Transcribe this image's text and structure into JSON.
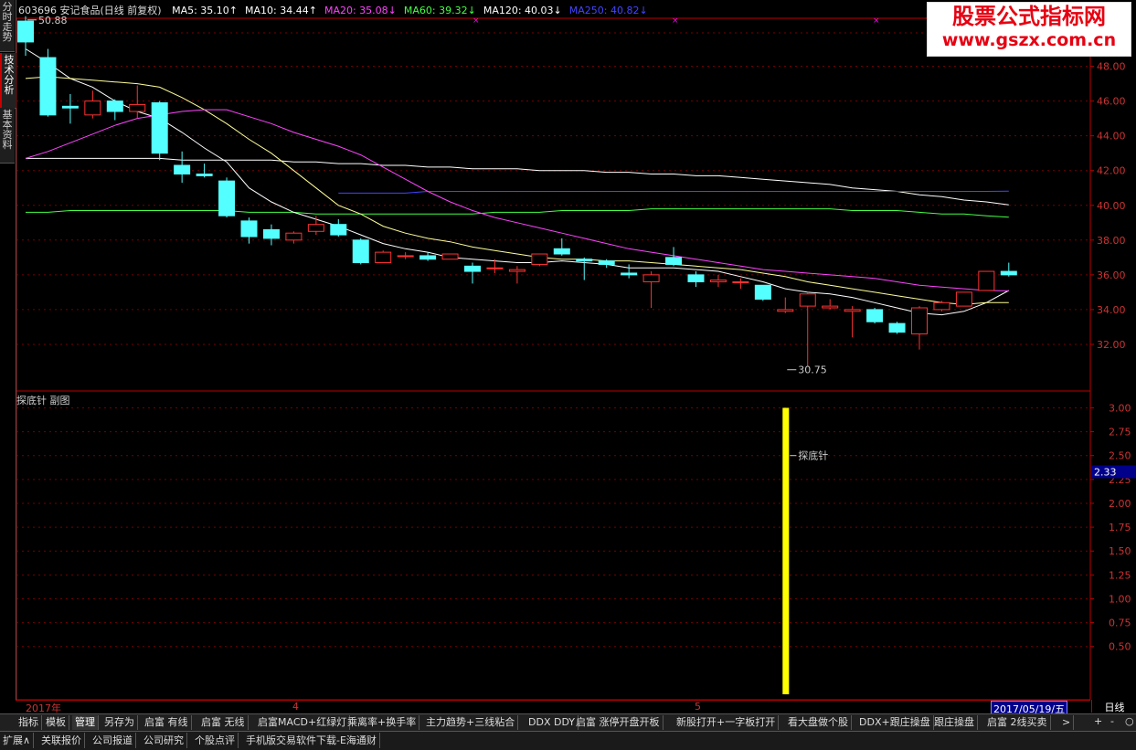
{
  "side_tabs": [
    {
      "label": "分时走势"
    },
    {
      "label": "技术分析"
    },
    {
      "label": "基本资料"
    }
  ],
  "header": {
    "stock": "603696 安记食品(日线 前复权)",
    "ma": [
      {
        "label": "MA5: 35.10",
        "arrow": "↑",
        "color": "#ffffff"
      },
      {
        "label": "MA10: 34.44",
        "arrow": "↑",
        "color": "#ffffff"
      },
      {
        "label": "MA20: 35.08",
        "arrow": "↓",
        "color": "#ff44ff"
      },
      {
        "label": "MA60: 39.32",
        "arrow": "↓",
        "color": "#44ff44"
      },
      {
        "label": "MA120: 40.03",
        "arrow": "↓",
        "color": "#ffffff"
      },
      {
        "label": "MA250: 40.82",
        "arrow": "↓",
        "color": "#4444ff"
      }
    ]
  },
  "logo": {
    "line1": "股票公式指标网",
    "line2": "www.gszx.com.cn"
  },
  "sub_chart_label": "探底针 副图",
  "axis_bar": {
    "labels": [
      {
        "text": "2017年",
        "x": 28
      },
      {
        "text": "4",
        "x": 320
      },
      {
        "text": "5",
        "x": 760
      }
    ],
    "date_flag": "2017/05/19/五",
    "period": "日线"
  },
  "toolbar": [
    {
      "label": "指标"
    },
    {
      "label": "模板"
    },
    {
      "label": "管理",
      "selected": true
    },
    {
      "label": "另存为"
    },
    {
      "label": "启富 有线"
    },
    {
      "label": "启富 无线"
    },
    {
      "label": "启富MACD+红绿灯"
    },
    {
      "label": "乘离率+换手率"
    },
    {
      "label": "主力趋势+三线粘合"
    },
    {
      "label": "DDX DDY"
    },
    {
      "label": "启富 涨停开盘开板"
    },
    {
      "label": "新股打开+一字板打开"
    },
    {
      "label": "看大盘做个股"
    },
    {
      "label": "DDX+跟庄操盘"
    },
    {
      "label": "跟庄操盘"
    },
    {
      "label": "启富 2线买卖"
    },
    {
      "label": ">"
    }
  ],
  "zoom_buttons": [
    "+",
    "-",
    "○"
  ],
  "bottom_bar": [
    {
      "label": "扩展∧"
    },
    {
      "label": "关联报价"
    },
    {
      "label": "公司报道"
    },
    {
      "label": "公司研究"
    },
    {
      "label": "个股点评"
    },
    {
      "label": "手机版交易软件下载-E海通财"
    }
  ],
  "chart_data": [
    {
      "type": "candlestick",
      "title": "603696 安记食品(日线 前复权)",
      "ylim": [
        30.0,
        50.5
      ],
      "y_ticks": [
        32.0,
        34.0,
        36.0,
        38.0,
        40.0,
        42.0,
        44.0,
        46.0,
        48.0
      ],
      "annotations": [
        {
          "text": "50.88",
          "kind": "high",
          "index": 0,
          "value": 50.88
        },
        {
          "text": "30.75",
          "kind": "low",
          "index": 34,
          "value": 30.75
        }
      ],
      "candles": [
        {
          "o": 50.6,
          "h": 50.88,
          "l": 48.6,
          "c": 49.4
        },
        {
          "o": 48.5,
          "h": 49.0,
          "l": 45.1,
          "c": 45.2
        },
        {
          "o": 45.7,
          "h": 46.4,
          "l": 44.7,
          "c": 45.6
        },
        {
          "o": 45.2,
          "h": 46.6,
          "l": 45.0,
          "c": 46.0
        },
        {
          "o": 46.0,
          "h": 46.1,
          "l": 44.9,
          "c": 45.4
        },
        {
          "o": 45.4,
          "h": 46.9,
          "l": 45.0,
          "c": 45.8
        },
        {
          "o": 45.9,
          "h": 46.0,
          "l": 42.6,
          "c": 43.0
        },
        {
          "o": 42.3,
          "h": 43.1,
          "l": 41.3,
          "c": 41.8
        },
        {
          "o": 41.8,
          "h": 42.4,
          "l": 41.6,
          "c": 41.7
        },
        {
          "o": 41.4,
          "h": 41.6,
          "l": 39.3,
          "c": 39.4
        },
        {
          "o": 39.1,
          "h": 39.3,
          "l": 37.8,
          "c": 38.2
        },
        {
          "o": 38.6,
          "h": 38.9,
          "l": 37.7,
          "c": 38.1
        },
        {
          "o": 38.0,
          "h": 38.5,
          "l": 37.8,
          "c": 38.4
        },
        {
          "o": 38.5,
          "h": 39.4,
          "l": 38.3,
          "c": 38.9
        },
        {
          "o": 38.9,
          "h": 39.2,
          "l": 38.2,
          "c": 38.3
        },
        {
          "o": 38.0,
          "h": 38.1,
          "l": 36.6,
          "c": 36.7
        },
        {
          "o": 36.7,
          "h": 37.4,
          "l": 36.7,
          "c": 37.3
        },
        {
          "o": 37.1,
          "h": 37.3,
          "l": 36.9,
          "c": 37.1
        },
        {
          "o": 37.1,
          "h": 37.3,
          "l": 36.8,
          "c": 36.9
        },
        {
          "o": 36.9,
          "h": 37.2,
          "l": 36.9,
          "c": 37.2
        },
        {
          "o": 36.5,
          "h": 36.7,
          "l": 35.5,
          "c": 36.2
        },
        {
          "o": 36.4,
          "h": 36.9,
          "l": 36.1,
          "c": 36.4
        },
        {
          "o": 36.2,
          "h": 36.5,
          "l": 35.5,
          "c": 36.3
        },
        {
          "o": 36.6,
          "h": 37.2,
          "l": 36.5,
          "c": 37.2
        },
        {
          "o": 37.5,
          "h": 38.1,
          "l": 37.1,
          "c": 37.2
        },
        {
          "o": 36.9,
          "h": 37.0,
          "l": 35.7,
          "c": 36.8
        },
        {
          "o": 36.8,
          "h": 36.9,
          "l": 36.4,
          "c": 36.6
        },
        {
          "o": 36.1,
          "h": 36.6,
          "l": 35.8,
          "c": 36.0
        },
        {
          "o": 35.6,
          "h": 36.2,
          "l": 34.1,
          "c": 36.0
        },
        {
          "o": 37.0,
          "h": 37.6,
          "l": 36.5,
          "c": 36.6
        },
        {
          "o": 36.0,
          "h": 36.2,
          "l": 35.3,
          "c": 35.6
        },
        {
          "o": 35.6,
          "h": 36.0,
          "l": 35.3,
          "c": 35.7
        },
        {
          "o": 35.6,
          "h": 35.8,
          "l": 35.2,
          "c": 35.6
        },
        {
          "o": 35.4,
          "h": 35.4,
          "l": 34.5,
          "c": 34.6
        },
        {
          "o": 33.9,
          "h": 34.7,
          "l": 33.8,
          "c": 34.0
        },
        {
          "o": 34.2,
          "h": 35.0,
          "l": 30.75,
          "c": 34.9
        },
        {
          "o": 34.1,
          "h": 34.6,
          "l": 34.0,
          "c": 34.2
        },
        {
          "o": 33.9,
          "h": 34.2,
          "l": 32.4,
          "c": 34.0
        },
        {
          "o": 34.0,
          "h": 34.1,
          "l": 33.2,
          "c": 33.3
        },
        {
          "o": 33.2,
          "h": 33.3,
          "l": 32.6,
          "c": 32.7
        },
        {
          "o": 32.6,
          "h": 34.2,
          "l": 31.7,
          "c": 34.1
        },
        {
          "o": 34.0,
          "h": 34.5,
          "l": 33.9,
          "c": 34.4
        },
        {
          "o": 34.2,
          "h": 35.0,
          "l": 34.2,
          "c": 35.0
        },
        {
          "o": 35.1,
          "h": 36.2,
          "l": 35.1,
          "c": 36.2
        },
        {
          "o": 36.2,
          "h": 36.7,
          "l": 35.9,
          "c": 36.0
        }
      ],
      "ma_lines": [
        {
          "name": "MA5",
          "color": "#ffffff",
          "values": [
            49.0,
            48.2,
            47.3,
            46.8,
            46.0,
            45.4,
            45.0,
            44.2,
            43.3,
            42.5,
            41.0,
            40.2,
            39.6,
            39.2,
            38.8,
            38.3,
            37.8,
            37.5,
            37.3,
            37.0,
            36.9,
            36.8,
            36.7,
            36.7,
            36.8,
            36.7,
            36.6,
            36.4,
            36.4,
            36.4,
            36.3,
            36.2,
            35.9,
            35.6,
            35.2,
            35.0,
            34.9,
            34.7,
            34.4,
            34.1,
            33.8,
            33.7,
            33.9,
            34.4,
            35.1
          ]
        },
        {
          "name": "MA10",
          "color": "#ffff99",
          "values": [
            47.3,
            47.4,
            47.3,
            47.2,
            47.1,
            47.0,
            46.8,
            46.2,
            45.5,
            44.7,
            43.8,
            43.0,
            42.0,
            41.0,
            40.0,
            39.5,
            38.8,
            38.4,
            38.1,
            37.9,
            37.6,
            37.4,
            37.2,
            37.0,
            36.9,
            36.9,
            36.8,
            36.8,
            36.7,
            36.6,
            36.5,
            36.4,
            36.3,
            36.1,
            35.9,
            35.6,
            35.4,
            35.2,
            35.0,
            34.8,
            34.6,
            34.4,
            34.3,
            34.4,
            34.4
          ]
        },
        {
          "name": "MA20",
          "color": "#ff44ff",
          "values": [
            42.7,
            43.1,
            43.6,
            44.1,
            44.6,
            45.0,
            45.2,
            45.4,
            45.5,
            45.5,
            45.1,
            44.7,
            44.2,
            43.8,
            43.4,
            42.9,
            42.2,
            41.5,
            40.8,
            40.2,
            39.7,
            39.3,
            39.0,
            38.7,
            38.4,
            38.1,
            37.8,
            37.5,
            37.3,
            37.1,
            36.9,
            36.7,
            36.5,
            36.3,
            36.2,
            36.1,
            36.0,
            35.9,
            35.8,
            35.6,
            35.4,
            35.3,
            35.2,
            35.1,
            35.08
          ]
        }
      ],
      "long_ma_lines": [
        {
          "name": "MA60",
          "color": "#44ff44",
          "start": 0,
          "values": [
            39.6,
            39.6,
            39.7,
            39.7,
            39.7,
            39.7,
            39.7,
            39.7,
            39.7,
            39.7,
            39.6,
            39.6,
            39.6,
            39.5,
            39.5,
            39.5,
            39.5,
            39.5,
            39.5,
            39.5,
            39.5,
            39.6,
            39.6,
            39.6,
            39.7,
            39.7,
            39.7,
            39.7,
            39.8,
            39.8,
            39.8,
            39.8,
            39.8,
            39.8,
            39.8,
            39.8,
            39.8,
            39.7,
            39.7,
            39.7,
            39.6,
            39.5,
            39.5,
            39.4,
            39.32
          ]
        },
        {
          "name": "MA120",
          "color": "#ffffff",
          "start": 0,
          "values": [
            42.7,
            42.7,
            42.7,
            42.7,
            42.7,
            42.7,
            42.7,
            42.6,
            42.6,
            42.6,
            42.6,
            42.6,
            42.5,
            42.5,
            42.4,
            42.4,
            42.3,
            42.3,
            42.2,
            42.2,
            42.1,
            42.1,
            42.1,
            42.0,
            42.0,
            42.0,
            41.9,
            41.9,
            41.8,
            41.8,
            41.7,
            41.7,
            41.6,
            41.5,
            41.4,
            41.3,
            41.2,
            41.0,
            40.9,
            40.8,
            40.6,
            40.5,
            40.3,
            40.2,
            40.03
          ]
        },
        {
          "name": "MA250",
          "color": "#4444ff",
          "start": 14,
          "values": [
            40.7,
            40.7,
            40.7,
            40.7,
            40.8,
            40.8,
            40.8,
            40.8,
            40.8,
            40.8,
            40.8,
            40.8,
            40.8,
            40.8,
            40.8,
            40.8,
            40.8,
            40.8,
            40.8,
            40.8,
            40.8,
            40.8,
            40.8,
            40.8,
            40.8,
            40.8,
            40.8,
            40.8,
            40.8,
            40.8,
            40.82
          ]
        }
      ]
    },
    {
      "type": "bar",
      "title": "探底针 副图",
      "ylim": [
        0,
        3.1
      ],
      "y_ticks": [
        0.5,
        0.75,
        1.0,
        1.25,
        1.5,
        1.75,
        2.0,
        2.25,
        2.5,
        2.75,
        3.0
      ],
      "current_value_label": "2.33",
      "series": [
        {
          "name": "探底针",
          "index": 34,
          "value": 3.0,
          "color": "#ffff00"
        }
      ],
      "annotation": {
        "text": "探底针",
        "value": 2.5
      }
    }
  ]
}
